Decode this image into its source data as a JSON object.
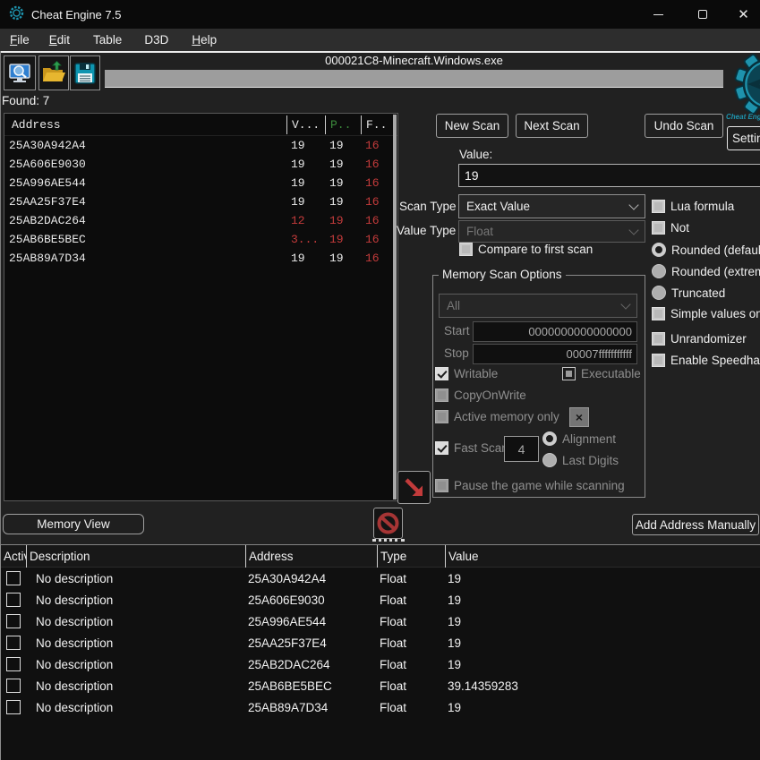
{
  "window": {
    "title": "Cheat Engine 7.5"
  },
  "menu": {
    "items": [
      "File",
      "Edit",
      "Table",
      "D3D",
      "Help"
    ]
  },
  "toolbar": {
    "process": "000021C8-Minecraft.Windows.exe"
  },
  "found_label": "Found: 7",
  "found_list": {
    "headers": {
      "address": "Address",
      "value": "V...",
      "previous": "P..",
      "first": "F.."
    },
    "rows": [
      {
        "address": "25A30A942A4",
        "value": "19",
        "previous": "19",
        "first": "16"
      },
      {
        "address": "25A606E9030",
        "value": "19",
        "previous": "19",
        "first": "16"
      },
      {
        "address": "25A996AE544",
        "value": "19",
        "previous": "19",
        "first": "16"
      },
      {
        "address": "25AA25F37E4",
        "value": "19",
        "previous": "19",
        "first": "16"
      },
      {
        "address": "25AB2DAC264",
        "value": "12",
        "previous": "19",
        "first": "16"
      },
      {
        "address": "25AB6BE5BEC",
        "value": "3...",
        "previous": "19",
        "first": "16"
      },
      {
        "address": "25AB89A7D34",
        "value": "19",
        "previous": "19",
        "first": "16"
      }
    ]
  },
  "scan": {
    "new_scan": "New Scan",
    "next_scan": "Next Scan",
    "undo_scan": "Undo Scan",
    "settings": "Settings",
    "value_label": "Value:",
    "value_input": "19",
    "scan_type_label": "Scan Type",
    "scan_type_value": "Exact Value",
    "value_type_label": "Value Type",
    "value_type_value": "Float",
    "compare_label": "Compare to first scan"
  },
  "options": {
    "lua_formula": "Lua formula",
    "not": "Not",
    "rounded_default": "Rounded (default",
    "rounded_extreme": "Rounded (extrem",
    "truncated": "Truncated",
    "simple_values": "Simple values onl",
    "unrandomizer": "Unrandomizer",
    "enable_speedhack": "Enable Speedhac"
  },
  "memory_scan_options": {
    "title": "Memory Scan Options",
    "region_value": "All",
    "start_label": "Start",
    "start_value": "0000000000000000",
    "stop_label": "Stop",
    "stop_value": "00007fffffffffff",
    "writable": "Writable",
    "executable": "Executable",
    "copy_on_write": "CopyOnWrite",
    "active_memory": "Active memory only",
    "x_button": "×",
    "fast_scan": "Fast Scan",
    "fast_scan_value": "4",
    "alignment": "Alignment",
    "last_digits": "Last Digits",
    "pause": "Pause the game while scanning"
  },
  "actions": {
    "memory_view": "Memory View",
    "add_address": "Add Address Manually"
  },
  "logo_caption": "Cheat Engine",
  "address_table": {
    "headers": [
      "Active",
      "Description",
      "Address",
      "Type",
      "Value"
    ],
    "rows": [
      {
        "description": "No description",
        "address": "25A30A942A4",
        "type": "Float",
        "value": "19"
      },
      {
        "description": "No description",
        "address": "25A606E9030",
        "type": "Float",
        "value": "19"
      },
      {
        "description": "No description",
        "address": "25A996AE544",
        "type": "Float",
        "value": "19"
      },
      {
        "description": "No description",
        "address": "25AA25F37E4",
        "type": "Float",
        "value": "19"
      },
      {
        "description": "No description",
        "address": "25AB2DAC264",
        "type": "Float",
        "value": "19"
      },
      {
        "description": "No description",
        "address": "25AB6BE5BEC",
        "type": "Float",
        "value": "39.14359283"
      },
      {
        "description": "No description",
        "address": "25AB89A7D34",
        "type": "Float",
        "value": "19"
      }
    ]
  },
  "colors": {
    "accent_red": "#c43b3b",
    "previous_green": "#3c8a3c",
    "logo_teal": "#1e93ad",
    "progress_gray": "#9d9d9d"
  }
}
